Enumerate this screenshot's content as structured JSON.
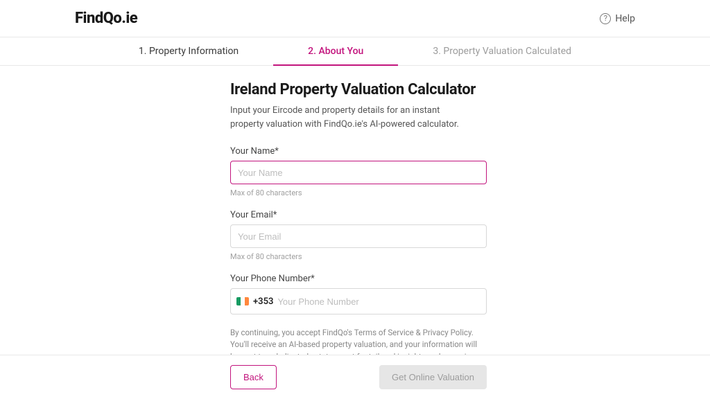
{
  "header": {
    "brand": "FindQo.ie",
    "help_label": "Help"
  },
  "steps": {
    "items": [
      {
        "label": "1. Property Information",
        "state": "completed"
      },
      {
        "label": "2. About You",
        "state": "active"
      },
      {
        "label": "3. Property Valuation Calculated",
        "state": "pending"
      }
    ]
  },
  "main": {
    "title": "Ireland Property Valuation Calculator",
    "subtitle": "Input your Eircode and property details for an instant property valuation with FindQo.ie's AI-powered calculator."
  },
  "form": {
    "name": {
      "label": "Your Name*",
      "placeholder": "Your Name",
      "hint": "Max of 80 characters"
    },
    "email": {
      "label": "Your Email*",
      "placeholder": "Your Email",
      "hint": "Max of 80 characters"
    },
    "phone": {
      "label": "Your Phone Number*",
      "country_code": "+353",
      "placeholder": "Your Phone Number"
    },
    "disclaimer": "By continuing, you accept FindQo's Terms of Service & Privacy Policy. You'll receive an AI-based property valuation, and your information will be sent to a dedicated estate agent for tailored insights and a precise valuation."
  },
  "footer": {
    "back_label": "Back",
    "submit_label": "Get Online Valuation"
  }
}
